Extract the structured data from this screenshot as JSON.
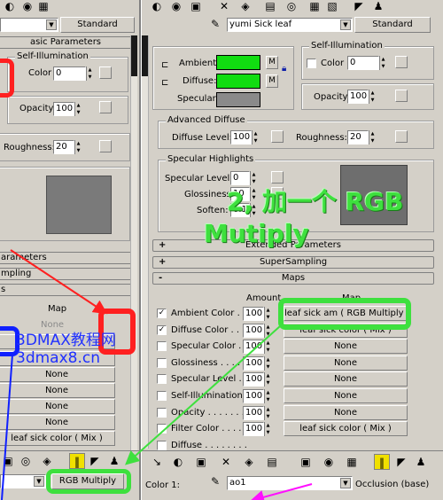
{
  "left": {
    "material_select": "",
    "material_type_button": "Standard",
    "basic_parameters_label": "asic Parameters",
    "self_illum": {
      "title": "Self-Illumination",
      "color_label": "Color",
      "value": "0"
    },
    "opacity": {
      "label": "Opacity:",
      "value": "100"
    },
    "roughness": {
      "label": "Roughness:",
      "value": "20"
    },
    "rollouts": [
      "arameters",
      "mpling",
      "s"
    ],
    "map_header": "Map",
    "map_none_1": "None",
    "map_slots": [
      "None",
      "None",
      "None",
      "None"
    ],
    "map_last": "leaf sick color ( Mix )",
    "bottom_button": "RGB Multiply",
    "watermark_1": "3DMAX教程网",
    "watermark_2": "3dmax8.cn"
  },
  "right": {
    "material_name": "yumi Sick leaf",
    "material_type_button": "Standard",
    "ambient_label": "Ambient:",
    "diffuse_label": "Diffuse:",
    "specular_label": "Specular:",
    "m_label": "M",
    "self_illum": {
      "title": "Self-Illumination",
      "color_label": "Color",
      "value": "0"
    },
    "opacity": {
      "label": "Opacity:",
      "value": "100"
    },
    "advanced_diffuse": {
      "title": "Advanced Diffuse",
      "diffuse_level_label": "Diffuse Level:",
      "diffuse_level": "100",
      "roughness_label": "Roughness:",
      "roughness": "20"
    },
    "specular_highlights": {
      "title": "Specular Highlights",
      "level_label": "Specular Level:",
      "level": "0",
      "gloss_label": "Glossiness:",
      "gloss": "10",
      "soften_label": "Soften:",
      "soften": "0.1"
    },
    "rollouts": [
      {
        "sign": "+",
        "label": "Extended Parameters"
      },
      {
        "sign": "+",
        "label": "SuperSampling"
      },
      {
        "sign": "-",
        "label": "Maps"
      }
    ],
    "maps_header": {
      "amount": "Amount",
      "map": "Map"
    },
    "maps": [
      {
        "checked": true,
        "label": "Ambient Color . . . .",
        "amount": "100",
        "map": "leaf sick am ( RGB Multiply )"
      },
      {
        "checked": true,
        "label": "Diffuse Color . . . .",
        "amount": "100",
        "map": "leaf sick color ( Mix )"
      },
      {
        "checked": false,
        "label": "Specular Color . . .",
        "amount": "100",
        "map": "None"
      },
      {
        "checked": false,
        "label": "Glossiness . . . . . .",
        "amount": "100",
        "map": "None"
      },
      {
        "checked": false,
        "label": "Specular Level . . .",
        "amount": "100",
        "map": "None"
      },
      {
        "checked": false,
        "label": "Self-Illumination . .",
        "amount": "100",
        "map": "None"
      },
      {
        "checked": false,
        "label": "Opacity . . . . . . . .",
        "amount": "100",
        "map": "None"
      },
      {
        "checked": false,
        "label": "Filter Color . . . . .",
        "amount": "100",
        "map": "leaf sick color ( Mix )"
      },
      {
        "checked": false,
        "label": "Diffuse . . . . . . . .",
        "amount": "",
        "map": ""
      }
    ],
    "color1_label": "Color 1:",
    "color1_value": "ao1",
    "color1_type": "Occlusion (base)"
  },
  "annotation": {
    "line1": "2, 加一个 RGB",
    "line2": "Mutiply"
  },
  "colors": {
    "ui_gray": "#d4d0c8",
    "ambient_green": "#11dd11",
    "highlight_green": "#3ee03e",
    "arrow_red": "#ff2020",
    "arrow_blue": "#1020ff",
    "arrow_magenta": "#ff10ff",
    "watermark_blue": "#2030ff"
  }
}
